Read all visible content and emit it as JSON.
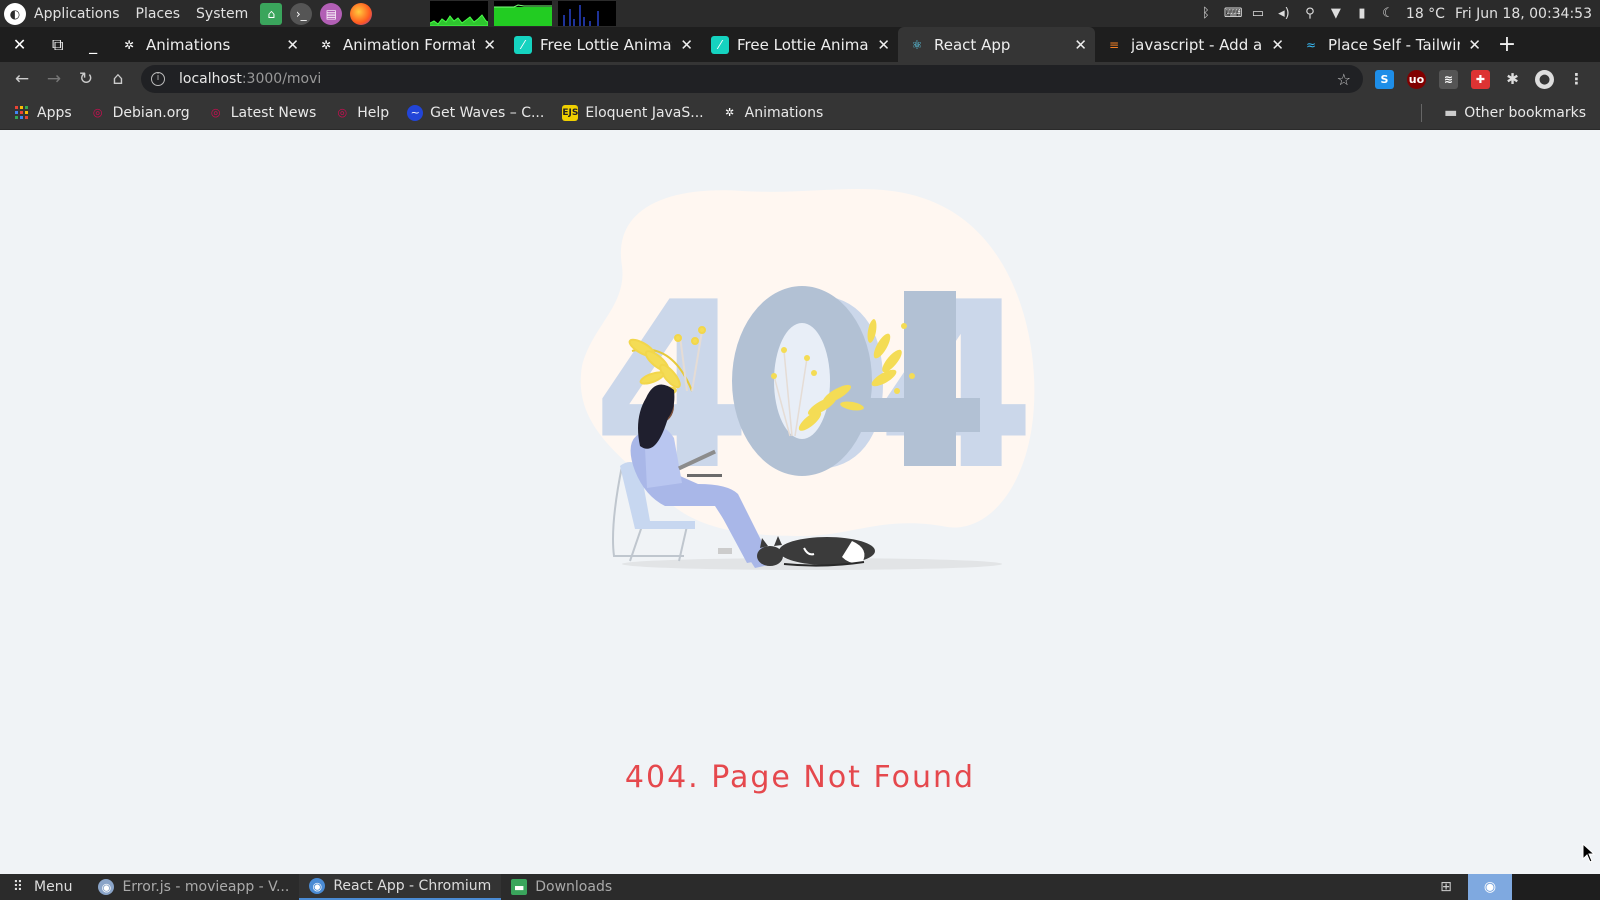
{
  "system_bar": {
    "menus": [
      "Applications",
      "Places",
      "System"
    ],
    "weather": "18 °C",
    "clock": "Fri Jun 18, 00:34:53"
  },
  "window_controls": [
    "close",
    "restore",
    "minimize"
  ],
  "tabs": [
    {
      "label": "Animations",
      "icon": "animations-icon",
      "active": false
    },
    {
      "label": "Animation Formats |",
      "icon": "animations-icon",
      "active": false
    },
    {
      "label": "Free Lottie Animatio",
      "icon": "lottie-icon",
      "active": false
    },
    {
      "label": "Free Lottie Animatio",
      "icon": "lottie-icon",
      "active": false
    },
    {
      "label": "React App",
      "icon": "react-icon",
      "active": true
    },
    {
      "label": "javascript - Add anim",
      "icon": "stackoverflow-icon",
      "active": false
    },
    {
      "label": "Place Self - Tailwind",
      "icon": "tailwind-icon",
      "active": false
    }
  ],
  "address_bar": {
    "host": "localhost",
    "path": ":3000/movi"
  },
  "bookmarks": [
    {
      "label": "Apps",
      "icon": "apps-grid-icon"
    },
    {
      "label": "Debian.org",
      "icon": "debian-icon"
    },
    {
      "label": "Latest News",
      "icon": "debian-icon"
    },
    {
      "label": "Help",
      "icon": "debian-icon"
    },
    {
      "label": "Get Waves – C...",
      "icon": "waves-icon"
    },
    {
      "label": "Eloquent JavaS...",
      "icon": "ejs-icon"
    },
    {
      "label": "Animations",
      "icon": "animations-icon"
    }
  ],
  "other_bookmarks": "Other bookmarks",
  "page": {
    "illustration_number": "404",
    "error_message": "404. Page Not Found",
    "accent_color": "#e5484d"
  },
  "taskbar": {
    "menu_label": "Menu",
    "items": [
      {
        "label": "Error.js - movieapp - V...",
        "active": false
      },
      {
        "label": "React App - Chromium",
        "active": true
      },
      {
        "label": "Downloads",
        "active": false
      }
    ]
  }
}
